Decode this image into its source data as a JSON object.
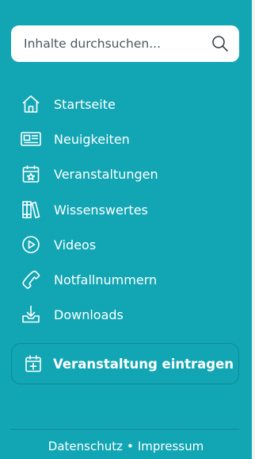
{
  "search": {
    "placeholder": "Inhalte durchsuchen..."
  },
  "nav": {
    "items": [
      {
        "label": "Startseite",
        "icon": "home-icon"
      },
      {
        "label": "Neuigkeiten",
        "icon": "newspaper-icon"
      },
      {
        "label": "Veranstaltungen",
        "icon": "calendar-star-icon"
      },
      {
        "label": "Wissenswertes",
        "icon": "books-icon"
      },
      {
        "label": "Videos",
        "icon": "play-circle-icon"
      },
      {
        "label": "Notfallnummern",
        "icon": "phone-icon"
      },
      {
        "label": "Downloads",
        "icon": "download-tray-icon"
      }
    ]
  },
  "cta": {
    "label": "Veranstaltung eintragen",
    "icon": "calendar-plus-icon"
  },
  "footer": {
    "privacy": "Datenschutz",
    "separator": "•",
    "imprint": "Impressum"
  },
  "colors": {
    "sidebar_bg": "#12a6b4",
    "text": "#ffffff",
    "border": "#0d8a96"
  }
}
